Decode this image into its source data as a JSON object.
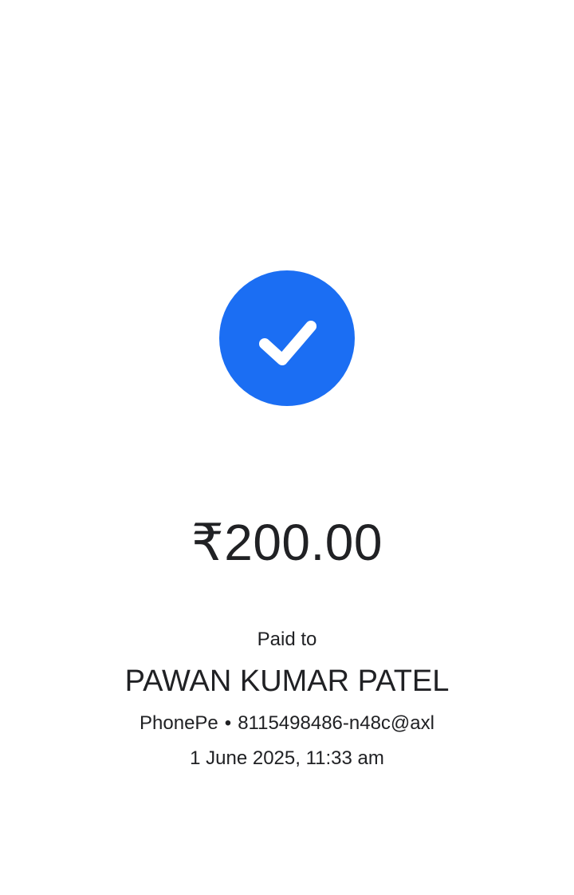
{
  "status": {
    "icon": "checkmark-icon",
    "color": "#1b6ef3"
  },
  "payment": {
    "amount": "₹200.00",
    "paid_label": "Paid to",
    "payee_name": "PAWAN KUMAR PATEL",
    "provider": "PhonePe",
    "separator": "•",
    "upi_id": "8115498486-n48c@axl",
    "timestamp": "1 June 2025, 11:33 am"
  }
}
